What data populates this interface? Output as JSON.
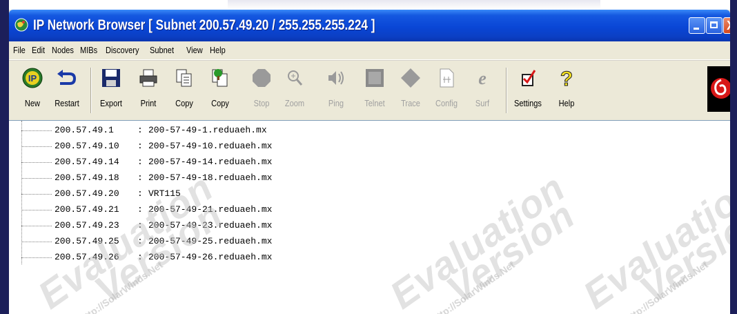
{
  "window": {
    "title": "IP Network Browser [ Subnet 200.57.49.20 / 255.255.255.224 ]",
    "controls": {
      "close_glyph": "X"
    },
    "colors": {
      "titlebar": "#0a46d6",
      "close": "#d8471c"
    }
  },
  "menu": [
    {
      "label": "File"
    },
    {
      "label": "Edit"
    },
    {
      "label": "Nodes"
    },
    {
      "label": "MIBs"
    },
    {
      "label": "Discovery"
    },
    {
      "label": "Subnet"
    },
    {
      "label": "View"
    },
    {
      "label": "Help"
    }
  ],
  "toolbar": [
    {
      "label": "New",
      "icon": "ip-icon",
      "enabled": true
    },
    {
      "label": "Restart",
      "icon": "restart-arrow-icon",
      "enabled": true
    },
    {
      "label": "Export",
      "icon": "floppy-disk-icon",
      "enabled": true
    },
    {
      "label": "Print",
      "icon": "printer-icon",
      "enabled": true
    },
    {
      "label": "Copy",
      "icon": "copy-pages-icon",
      "enabled": true
    },
    {
      "label": "Copy",
      "icon": "copy-tree-icon",
      "enabled": true
    },
    {
      "label": "Stop",
      "icon": "stop-icon",
      "enabled": false
    },
    {
      "label": "Zoom",
      "icon": "zoom-icon",
      "enabled": false
    },
    {
      "label": "Ping",
      "icon": "speaker-icon",
      "enabled": false
    },
    {
      "label": "Telnet",
      "icon": "terminal-icon",
      "enabled": false
    },
    {
      "label": "Trace",
      "icon": "diamond-icon",
      "enabled": false
    },
    {
      "label": "Config",
      "icon": "config-doc-icon",
      "enabled": false
    },
    {
      "label": "Surf",
      "icon": "browser-e-icon",
      "enabled": false
    },
    {
      "label": "Settings",
      "icon": "settings-checklist-icon",
      "enabled": true
    },
    {
      "label": "Help",
      "icon": "question-mark-icon",
      "enabled": true
    }
  ],
  "nodes": [
    {
      "ip": "200.57.49.1",
      "host": "200-57-49-1.reduaeh.mx"
    },
    {
      "ip": "200.57.49.10",
      "host": "200-57-49-10.reduaeh.mx"
    },
    {
      "ip": "200.57.49.14",
      "host": "200-57-49-14.reduaeh.mx"
    },
    {
      "ip": "200.57.49.18",
      "host": "200-57-49-18.reduaeh.mx"
    },
    {
      "ip": "200.57.49.20",
      "host": "VRT115"
    },
    {
      "ip": "200.57.49.21",
      "host": "200-57-49-21.reduaeh.mx"
    },
    {
      "ip": "200.57.49.23",
      "host": "200-57-49-23.reduaeh.mx"
    },
    {
      "ip": "200.57.49.25",
      "host": "200-57-49-25.reduaeh.mx"
    },
    {
      "ip": "200.57.49.26",
      "host": "200-57-49-26.reduaeh.mx"
    }
  ],
  "separator": ":",
  "watermark": {
    "line1": "Evaluation",
    "line2": "Version",
    "url": "http://SolarWinds.Net"
  }
}
